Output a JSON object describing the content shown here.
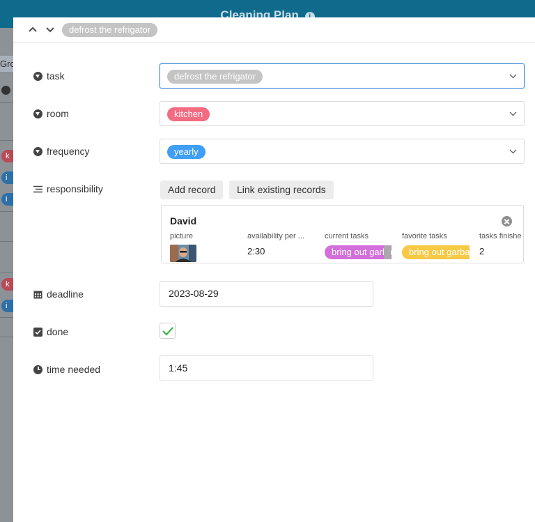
{
  "background": {
    "app_title": "Cleaning Plan",
    "info_glyph": "i",
    "group_label": "Gro",
    "pills": [
      {
        "text": "k",
        "color": "#b84b57"
      },
      {
        "text": "i",
        "color": "#2e6fa8"
      },
      {
        "text": "i",
        "color": "#2e6fa8"
      },
      {
        "text": "k",
        "color": "#b84b57"
      },
      {
        "text": "i",
        "color": "#2e6fa8"
      }
    ]
  },
  "record": {
    "title": "defrost the refrigator",
    "nav_icons": [
      "chevron-up-icon",
      "chevron-down-icon"
    ]
  },
  "fields": {
    "task": {
      "label": "task",
      "value": "defrost the refrigator",
      "icon": "circle-chevron-icon"
    },
    "room": {
      "label": "room",
      "value": "kitchen",
      "color": "#f26b80",
      "icon": "circle-chevron-icon"
    },
    "frequency": {
      "label": "frequency",
      "value": "yearly",
      "color": "#3f9ef5",
      "icon": "circle-chevron-icon"
    },
    "responsibility": {
      "label": "responsibility",
      "icon": "list-icon",
      "add_record_label": "Add record",
      "link_existing_label": "Link existing records",
      "linked": {
        "name": "David",
        "columns": [
          "picture",
          "availability per ...",
          "current tasks",
          "favorite tasks",
          "tasks finishe"
        ],
        "availability": "2:30",
        "current_task": "bring out garbage",
        "favorite_task": "bring out garbage",
        "tasks_finished": "2"
      }
    },
    "deadline": {
      "label": "deadline",
      "value": "2023-08-29",
      "icon": "calendar-icon"
    },
    "done": {
      "label": "done",
      "checked": true,
      "icon": "checkbox-icon"
    },
    "time_needed": {
      "label": "time needed",
      "value": "1:45",
      "icon": "clock-icon"
    }
  },
  "colors": {
    "header": "#0f6a8c",
    "check": "#3cb54a",
    "focus_border": "#4a90d9",
    "current_task_chip": "#d36fdb",
    "favorite_task_chip": "#f7c944"
  }
}
